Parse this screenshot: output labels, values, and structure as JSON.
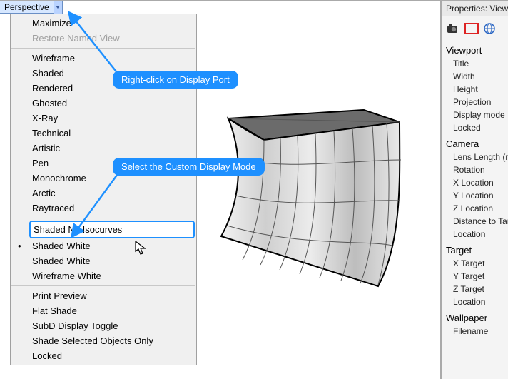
{
  "viewport_tab": {
    "label": "Perspective"
  },
  "menu": {
    "g1": {
      "maximize": "Maximize",
      "restore": "Restore Named View"
    },
    "g2": {
      "wireframe": "Wireframe",
      "shaded": "Shaded",
      "rendered": "Rendered",
      "ghosted": "Ghosted",
      "xray": "X-Ray",
      "technical": "Technical",
      "artistic": "Artistic",
      "pen": "Pen",
      "monochrome": "Monochrome",
      "arctic": "Arctic",
      "raytraced": "Raytraced"
    },
    "g3": {
      "shaded_no_iso": "Shaded No Isocurves",
      "shaded_white1": "Shaded White",
      "shaded_white2": "Shaded White",
      "wireframe_white": "Wireframe White"
    },
    "g4": {
      "print_preview": "Print Preview",
      "flat_shade": "Flat Shade",
      "subd_toggle": "SubD Display Toggle",
      "shade_sel": "Shade Selected Objects Only",
      "locked": "Locked"
    }
  },
  "callouts": {
    "c1": "Right-click on Display Port",
    "c2": "Select the Custom Display Mode"
  },
  "props": {
    "title": "Properties: Viewport",
    "sections": {
      "viewport": {
        "label": "Viewport",
        "rows": {
          "title": "Title",
          "width": "Width",
          "height": "Height",
          "projection": "Projection",
          "display_mode": "Display mode",
          "locked": "Locked"
        }
      },
      "camera": {
        "label": "Camera",
        "rows": {
          "lens": "Lens Length (mm)",
          "rotation": "Rotation",
          "xloc": "X Location",
          "yloc": "Y Location",
          "zloc": "Z Location",
          "dist": "Distance to Target",
          "loc": "Location"
        }
      },
      "target": {
        "label": "Target",
        "rows": {
          "xt": "X Target",
          "yt": "Y Target",
          "zt": "Z Target",
          "loc": "Location"
        }
      },
      "wallpaper": {
        "label": "Wallpaper",
        "rows": {
          "filename": "Filename"
        }
      }
    }
  }
}
